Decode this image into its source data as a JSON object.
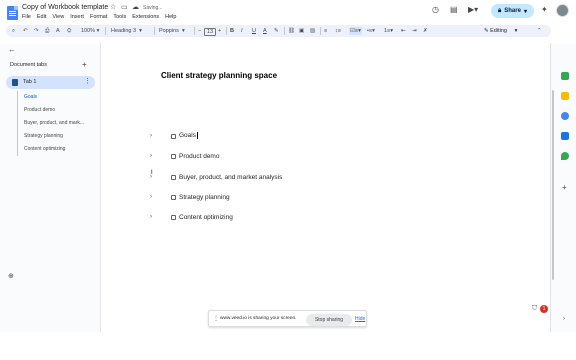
{
  "document": {
    "title": "Copy of Workbook template",
    "save_status": "Saving...",
    "heading": "Client strategy planning space",
    "items": [
      {
        "label": "Goals"
      },
      {
        "label": "Product demo"
      },
      {
        "label": "Buyer, product, and market analysis"
      },
      {
        "label": "Strategy planning"
      },
      {
        "label": "Content optimizing"
      }
    ]
  },
  "menubar": [
    "File",
    "Edit",
    "View",
    "Insert",
    "Format",
    "Tools",
    "Extensions",
    "Help"
  ],
  "header": {
    "share_label": "Share",
    "icons": [
      "history-icon",
      "comment-icon",
      "meet-icon",
      "gemini-icon",
      "avatar"
    ]
  },
  "toolbar": {
    "zoom": "100%",
    "style": "Heading 3",
    "font": "Poppins",
    "font_size": "13",
    "mode": "Editing"
  },
  "sidebar": {
    "heading": "Document tabs",
    "tab": "Tab 1",
    "outline": [
      "Goals",
      "Product demo",
      "Buyer, product, and mark...",
      "Strategy planning",
      "Content optimizing"
    ],
    "active_outline_index": 0
  },
  "share_bar": {
    "message": "www.veed.io is sharing your screen.",
    "stop_label": "Stop sharing",
    "hide_label": "Hide"
  },
  "badge": {
    "count": "1"
  },
  "colors": {
    "accent": "#0b57d0",
    "share_button": "#c2e7ff",
    "active_tab": "#d3e3fd",
    "toolbar_bg": "#edf2fa",
    "badge": "#d93025"
  }
}
